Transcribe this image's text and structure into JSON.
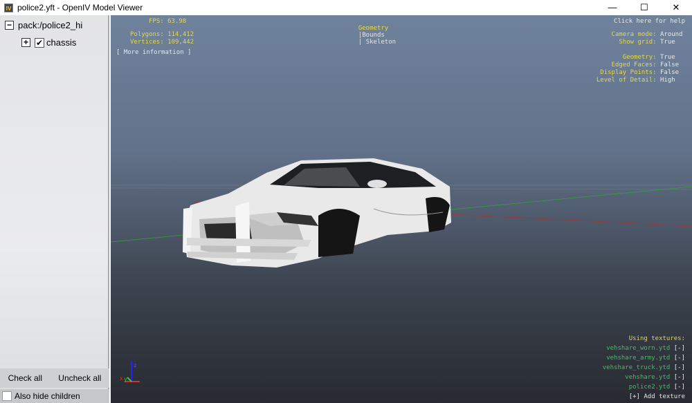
{
  "window": {
    "title": "police2.yft - OpenIV Model Viewer",
    "icon": "IV",
    "minimize": "—",
    "maximize": "☐",
    "close": "✕"
  },
  "tree": {
    "root": "pack:/police2_hi",
    "root_expander": "−",
    "child": "chassis",
    "child_expander": "+",
    "child_checked": "✔"
  },
  "buttons": {
    "check_all": "Check all",
    "uncheck_all": "Uncheck all",
    "also_hide_children": "Also hide children"
  },
  "hud": {
    "fps_label": "FPS:",
    "fps": "63.98",
    "polygons_label": "Polygons:",
    "polygons": "114,412",
    "vertices_label": "Vertices:",
    "vertices": "109,442",
    "more_info": "[ More information ]",
    "modes": [
      "Geometry",
      "Bounds",
      "Skeleton"
    ],
    "sep": "|",
    "help": "Click here for help",
    "settings": [
      {
        "label": "Camera mode:",
        "value": "Around"
      },
      {
        "label": "Show grid:",
        "value": "True"
      },
      {
        "label": "Geometry:",
        "value": "True"
      },
      {
        "label": "Edged Faces:",
        "value": "False"
      },
      {
        "label": "Display Points:",
        "value": "False"
      },
      {
        "label": "Level of Detail:",
        "value": "High"
      }
    ],
    "textures_title": "Using textures:",
    "textures": [
      "vehshare_worn.ytd",
      "vehshare_army.ytd",
      "vehshare_truck.ytd",
      "vehshare.ytd",
      "police2.ytd"
    ],
    "remove": "[-]",
    "add_texture": "[+] Add texture",
    "axes": {
      "x": "x",
      "y": "y",
      "z": "z"
    }
  }
}
